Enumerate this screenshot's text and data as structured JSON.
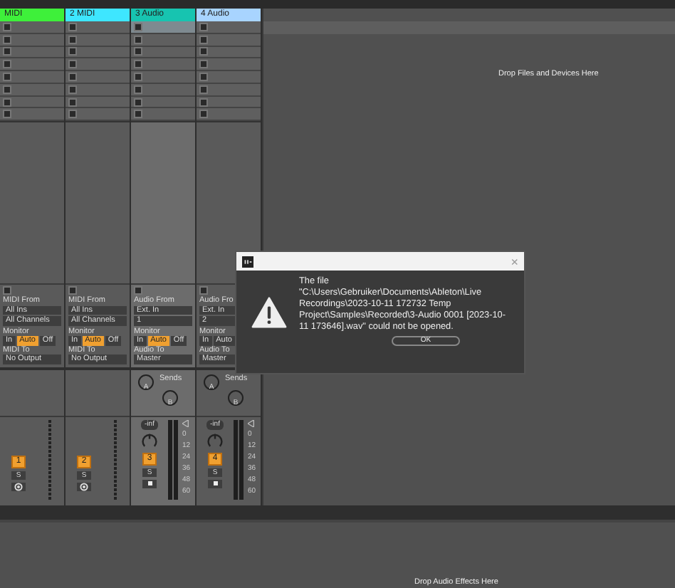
{
  "tracks": [
    {
      "name": "MIDI",
      "color": "#3ef03a",
      "kind": "midi",
      "selected": false,
      "io": {
        "from_label": "MIDI From",
        "from": "All Ins",
        "channel": "All Channels",
        "monitor_label": "Monitor",
        "monitor": [
          {
            "label": "In",
            "selected": false
          },
          {
            "label": "Auto",
            "selected": true
          },
          {
            "label": "Off",
            "selected": false
          }
        ],
        "to_label": "MIDI To",
        "to": "No Output"
      },
      "number": "1",
      "solo": "S"
    },
    {
      "name": "2 MIDI",
      "color": "#3ee6ff",
      "kind": "midi",
      "selected": false,
      "io": {
        "from_label": "MIDI From",
        "from": "All Ins",
        "channel": "All Channels",
        "monitor_label": "Monitor",
        "monitor": [
          {
            "label": "In",
            "selected": false
          },
          {
            "label": "Auto",
            "selected": true
          },
          {
            "label": "Off",
            "selected": false
          }
        ],
        "to_label": "MIDI To",
        "to": "No Output"
      },
      "number": "2",
      "solo": "S"
    },
    {
      "name": "3 Audio",
      "color": "#17c4b0",
      "kind": "audio",
      "selected": true,
      "io": {
        "from_label": "Audio From",
        "from": "Ext. In",
        "channel": "1",
        "monitor_label": "Monitor",
        "monitor": [
          {
            "label": "In",
            "selected": false
          },
          {
            "label": "Auto",
            "selected": true
          },
          {
            "label": "Off",
            "selected": false
          }
        ],
        "to_label": "Audio To",
        "to": "Master"
      },
      "sends_label": "Sends",
      "sends": [
        "A",
        "B"
      ],
      "volume": "-inf",
      "scale": [
        "0",
        "12",
        "24",
        "36",
        "48",
        "60"
      ],
      "number": "3",
      "solo": "S"
    },
    {
      "name": "4 Audio",
      "color": "#a8d4ff",
      "kind": "audio",
      "selected": false,
      "io": {
        "from_label": "Audio Fro",
        "from": "Ext. In",
        "channel": "2",
        "monitor_label": "Monitor",
        "monitor": [
          {
            "label": "In",
            "selected": false
          },
          {
            "label": "Auto",
            "selected": false
          }
        ],
        "to_label": "Audio To",
        "to": "Master"
      },
      "sends_label": "Sends",
      "sends": [
        "A",
        "B"
      ],
      "volume": "-inf",
      "scale": [
        "0",
        "12",
        "24",
        "36",
        "48",
        "60"
      ],
      "number": "4",
      "solo": "S"
    }
  ],
  "drop_hint": "Drop Files and Devices Here",
  "device_hint": "Drop Audio Effects Here",
  "dialog": {
    "close": "×",
    "heading": "The file",
    "message": "\"C:\\Users\\Gebruiker\\Documents\\Ableton\\Live Recordings\\2023-10-11 172732 Temp Project\\Samples\\Recorded\\3-Audio 0001 [2023-10-11 173646].wav\" could not be opened.",
    "button": "OK"
  }
}
